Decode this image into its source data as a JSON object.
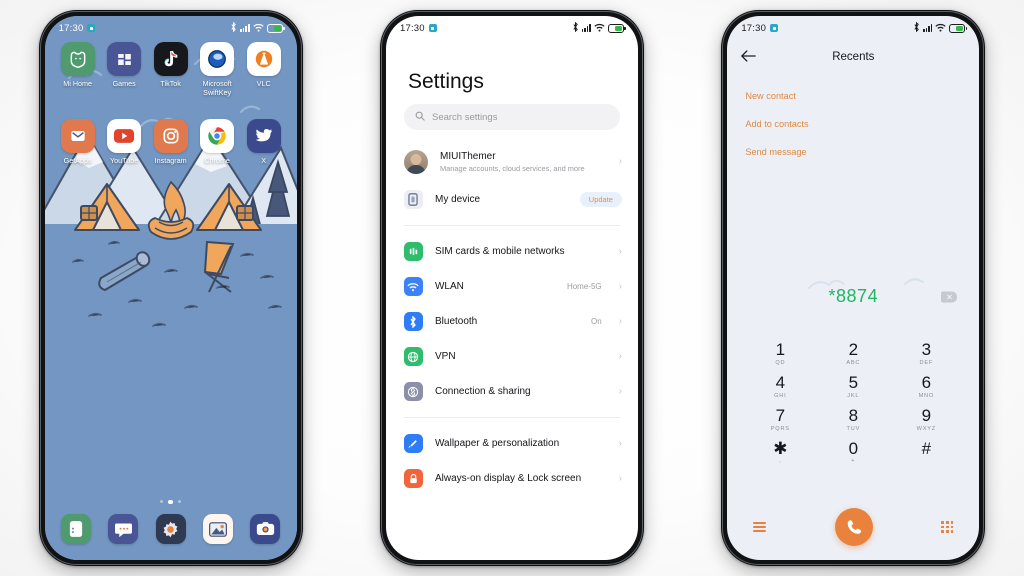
{
  "status_bar": {
    "time": "17:30",
    "icons": [
      "app-badge-icon",
      "bluetooth-icon",
      "signal-icon",
      "wifi-icon",
      "battery-icon"
    ]
  },
  "home_screen": {
    "wallpaper_name": "camping-illustration-wallpaper",
    "colors": {
      "sky": "#7396c2",
      "tent": "#f0a75c",
      "ink": "#3d4a63",
      "mountain": "#cfd8e6"
    },
    "apps_row1": [
      {
        "label": "Mi Home",
        "icon": "mi-home-icon",
        "bg": "#4f9a6f",
        "fg": "#ffffff"
      },
      {
        "label": "Games",
        "icon": "games-icon",
        "bg": "#4a5596",
        "fg": "#ffffff"
      },
      {
        "label": "TikTok",
        "icon": "tiktok-icon",
        "bg": "#17181c",
        "fg": "#ffffff"
      },
      {
        "label": "Microsoft SwiftKey",
        "icon": "swiftkey-icon",
        "bg": "#ffffff",
        "fg": "#1b5fbe"
      },
      {
        "label": "VLC",
        "icon": "vlc-icon",
        "bg": "#ffffff",
        "fg": "#ef7f21"
      }
    ],
    "apps_row2": [
      {
        "label": "GetApps",
        "icon": "getapps-icon",
        "bg": "#e07a4e",
        "fg": "#ffffff"
      },
      {
        "label": "YouTube",
        "icon": "youtube-icon",
        "bg": "#ffffff",
        "fg": "#e0452c"
      },
      {
        "label": "Instagram",
        "icon": "instagram-icon",
        "bg": "#e07a4e",
        "fg": "#ffffff"
      },
      {
        "label": "Chrome",
        "icon": "chrome-icon",
        "bg": "#ffffff",
        "fg": "#4285f4"
      },
      {
        "label": "X",
        "icon": "x-twitter-icon",
        "bg": "#3b4a8c",
        "fg": "#ffffff"
      }
    ],
    "pager": {
      "total": 3,
      "active": 2
    },
    "dock": [
      {
        "label": "Phone",
        "icon": "phone-icon",
        "bg": "#4f9a6f"
      },
      {
        "label": "Messages",
        "icon": "messages-icon",
        "bg": "#4a5596"
      },
      {
        "label": "Settings",
        "icon": "settings-gear-icon",
        "bg": "#2f3a52"
      },
      {
        "label": "Gallery",
        "icon": "gallery-icon",
        "bg": "#fdf6f0"
      },
      {
        "label": "Camera",
        "icon": "camera-icon",
        "bg": "#3b4a8c"
      }
    ]
  },
  "settings_screen": {
    "title": "Settings",
    "search": {
      "placeholder": "Search settings",
      "icon": "search-icon"
    },
    "account": {
      "name": "MIUIThemer",
      "subtitle": "Manage accounts, cloud services, and more",
      "avatar": "user-avatar"
    },
    "device": {
      "label": "My device",
      "badge": "Update",
      "icon": "device-icon"
    },
    "group1": [
      {
        "label": "SIM cards & mobile networks",
        "value": "",
        "icon": "sim-card-icon",
        "color": "#2fbd6d"
      },
      {
        "label": "WLAN",
        "value": "Home-5G",
        "icon": "wifi-icon",
        "color": "#3b82f6"
      },
      {
        "label": "Bluetooth",
        "value": "On",
        "icon": "bluetooth-icon",
        "color": "#2f7df6"
      },
      {
        "label": "VPN",
        "value": "",
        "icon": "vpn-globe-icon",
        "color": "#2fbd6d"
      },
      {
        "label": "Connection & sharing",
        "value": "",
        "icon": "link-icon",
        "color": "#8b8fa8"
      }
    ],
    "group2": [
      {
        "label": "Wallpaper & personalization",
        "value": "",
        "icon": "brush-icon",
        "color": "#2f7df6"
      },
      {
        "label": "Always-on display & Lock screen",
        "value": "",
        "icon": "lock-icon",
        "color": "#f2643c"
      }
    ],
    "chevron": "›"
  },
  "dialer_screen": {
    "back_icon": "back-arrow-icon",
    "title": "Recents",
    "actions": [
      {
        "label": "New contact",
        "name": "new-contact-action"
      },
      {
        "label": "Add to contacts",
        "name": "add-to-contacts-action"
      },
      {
        "label": "Send message",
        "name": "send-message-action"
      }
    ],
    "dialed_number": "*8874",
    "number_color": "#22b562",
    "delete_icon": "backspace-icon",
    "accent_color": "#e8823c",
    "keys": [
      {
        "num": "1",
        "sub": "QD"
      },
      {
        "num": "2",
        "sub": "ABC"
      },
      {
        "num": "3",
        "sub": "DEF"
      },
      {
        "num": "4",
        "sub": "GHI"
      },
      {
        "num": "5",
        "sub": "JKL"
      },
      {
        "num": "6",
        "sub": "MNO"
      },
      {
        "num": "7",
        "sub": "PQRS"
      },
      {
        "num": "8",
        "sub": "TUV"
      },
      {
        "num": "9",
        "sub": "WXYZ"
      },
      {
        "num": "✱",
        "sub": ","
      },
      {
        "num": "0",
        "sub": "+"
      },
      {
        "num": "#",
        "sub": ""
      }
    ],
    "bottom_bar": {
      "menu_icon": "menu-hamburger-icon",
      "call_icon": "call-button-icon",
      "keypad_icon": "keypad-grid-icon"
    }
  }
}
